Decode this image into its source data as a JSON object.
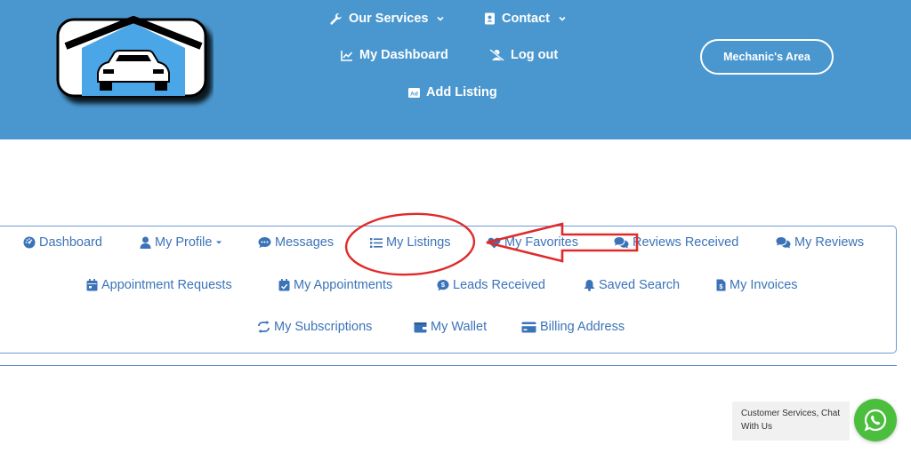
{
  "header": {
    "nav": {
      "our_services": "Our Services",
      "contact": "Contact",
      "my_dashboard": "My Dashboard",
      "log_out": "Log out",
      "add_listing": "Add Listing"
    },
    "mechanics_area": "Mechanic's Area",
    "icons": [
      "wrench-icon",
      "contact-card-icon",
      "chart-line-icon",
      "user-slash-icon",
      "ad-icon"
    ],
    "bg_color": "#4a97cf"
  },
  "account_menu": {
    "dashboard": "Dashboard",
    "my_profile": "My Profile",
    "messages": "Messages",
    "my_listings": "My Listings",
    "my_favorites": "My Favorites",
    "reviews_received": "Reviews Received",
    "my_reviews": "My Reviews",
    "appointment_requests": "Appointment Requests",
    "my_appointments": "My Appointments",
    "leads_received": "Leads Received",
    "saved_search": "Saved Search",
    "my_invoices": "My Invoices",
    "my_subscriptions": "My Subscriptions",
    "my_wallet": "My Wallet",
    "billing_address": "Billing Address",
    "link_color": "#3b73b8"
  },
  "annotation_color": "#e02a2a",
  "chat": {
    "label": "Customer Services, Chat With Us",
    "button_color": "#4bbf3d"
  }
}
